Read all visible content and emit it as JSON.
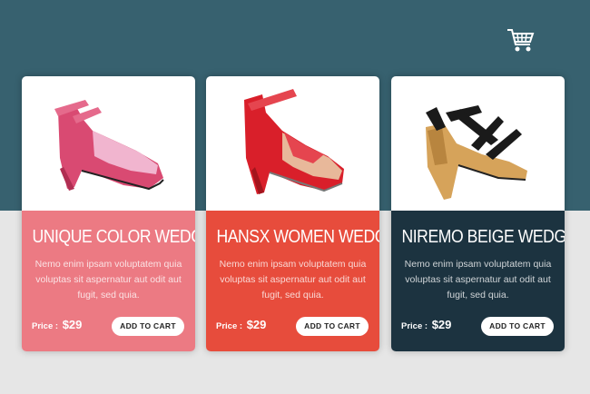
{
  "header": {
    "cart_icon": "shopping-cart-icon"
  },
  "colors": {
    "background_top": "#37616f",
    "background_bottom": "#e6e6e6",
    "card_1": "#ec7a83",
    "card_2": "#e74c3c",
    "card_3": "#1c3340"
  },
  "products": [
    {
      "title": "UNIQUE COLOR WEDGES",
      "description": "Nemo enim ipsam voluptatem quia voluptas sit aspernatur aut odit aut fugit, sed quia.",
      "price_label": "Price :",
      "price": "$29",
      "button": "ADD TO CART"
    },
    {
      "title": "HANSX WOMEN WEDGES",
      "description": "Nemo enim ipsam voluptatem quia voluptas sit aspernatur aut odit aut fugit, sed quia.",
      "price_label": "Price :",
      "price": "$29",
      "button": "ADD TO CART"
    },
    {
      "title": "NIREMO BEIGE WEDGES",
      "description": "Nemo enim ipsam voluptatem quia voluptas sit aspernatur aut odit aut fugit, sed quia.",
      "price_label": "Price :",
      "price": "$29",
      "button": "ADD TO CART"
    }
  ]
}
